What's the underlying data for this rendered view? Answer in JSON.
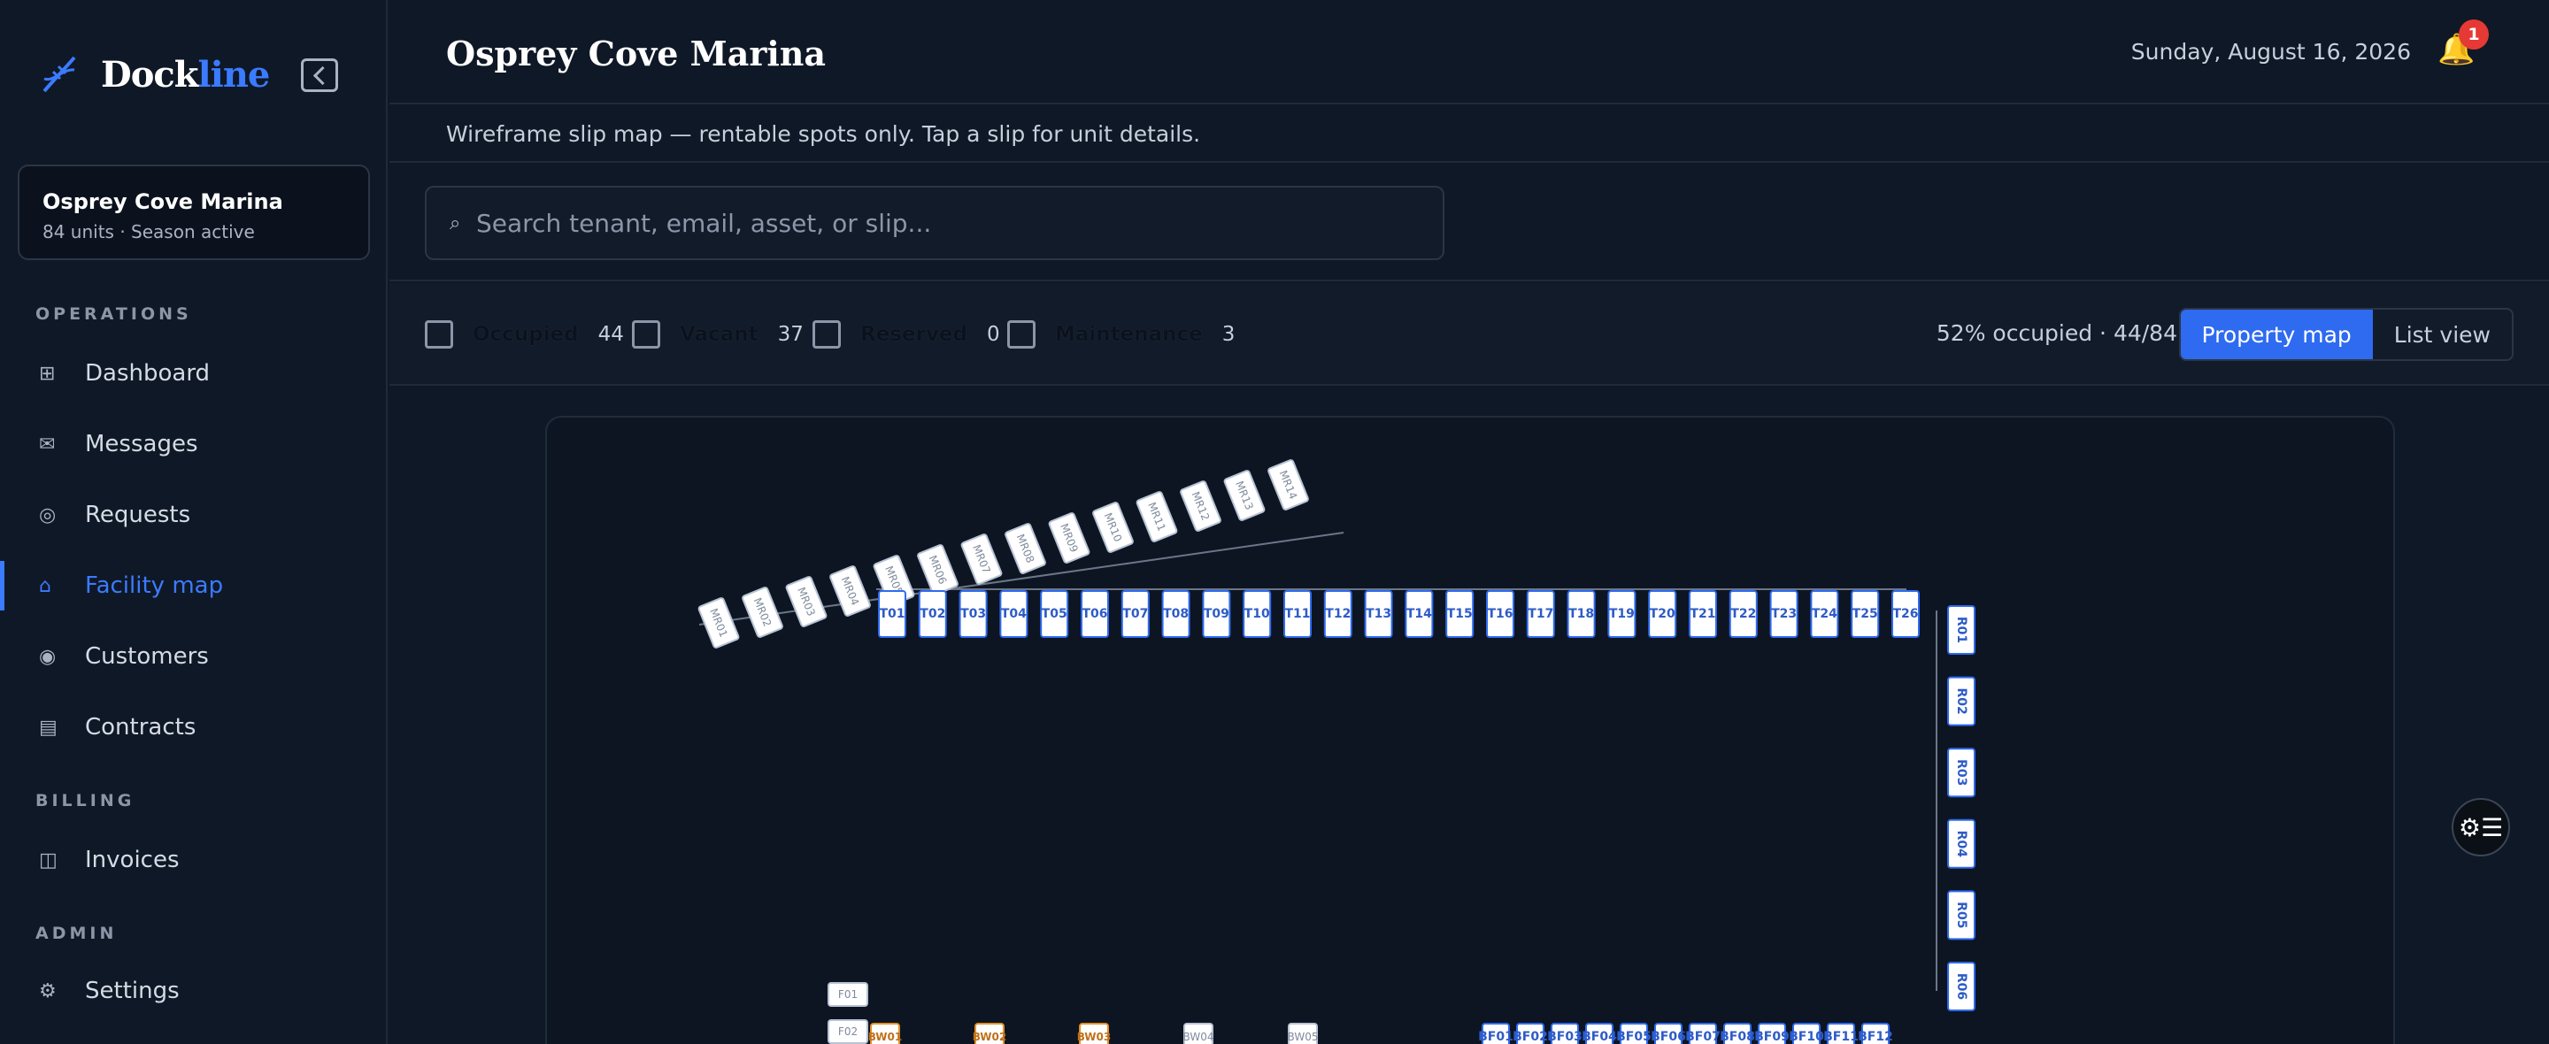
{
  "brand": {
    "name_main": "Dock",
    "name_accent": "line"
  },
  "property": {
    "name": "Osprey Cove Marina",
    "subtitle": "84 units · Season active"
  },
  "nav": {
    "operations_label": "OPERATIONS",
    "billing_label": "BILLING",
    "admin_label": "ADMIN",
    "items": [
      {
        "label": "Dashboard",
        "icon": "grid-icon"
      },
      {
        "label": "Messages",
        "icon": "mail-icon"
      },
      {
        "label": "Requests",
        "icon": "circle-icon"
      },
      {
        "label": "Facility map",
        "icon": "home-icon",
        "active": true
      },
      {
        "label": "Customers",
        "icon": "user-icon"
      },
      {
        "label": "Contracts",
        "icon": "file-icon"
      },
      {
        "label": "Invoices",
        "icon": "invoice-icon"
      },
      {
        "label": "Settings",
        "icon": "gear-icon"
      }
    ]
  },
  "header": {
    "title": "Osprey Cove Marina",
    "date": "Sunday, August 16, 2026",
    "notifications": "1"
  },
  "subheader": {
    "text": "Wireframe slip map — rentable spots only. Tap a slip for unit details."
  },
  "search": {
    "placeholder": "Search tenant, email, asset, or slip..."
  },
  "filters": [
    {
      "label": "Occupied",
      "count": "44"
    },
    {
      "label": "Vacant",
      "count": "37"
    },
    {
      "label": "Reserved",
      "count": "0"
    },
    {
      "label": "Maintenance",
      "count": "3"
    }
  ],
  "summary": {
    "text": "52% occupied · 44/84"
  },
  "view_toggle": {
    "property_map": "Property map",
    "list_view": "List view"
  },
  "map": {
    "mr_slips": [
      "MR01",
      "MR02",
      "MR03",
      "MR04",
      "MR05",
      "MR06",
      "MR07",
      "MR08",
      "MR09",
      "MR10",
      "MR11",
      "MR12",
      "MR13",
      "MR14"
    ],
    "t_slips": [
      "T01",
      "T02",
      "T03",
      "T04",
      "T05",
      "T06",
      "T07",
      "T08",
      "T09",
      "T10",
      "T11",
      "T12",
      "T13",
      "T14",
      "T15",
      "T16",
      "T17",
      "T18",
      "T19",
      "T20",
      "T21",
      "T22",
      "T23",
      "T24",
      "T25",
      "T26"
    ],
    "r_slips": [
      "R01",
      "R02",
      "R03",
      "R04",
      "R05",
      "R06"
    ],
    "f_slips": [
      "F01",
      "F02"
    ],
    "bw_slips": [
      "BW01",
      "BW02",
      "BW03",
      "BW04",
      "BW05"
    ],
    "bf_slips": [
      "BF01",
      "BF02",
      "BF03",
      "BF04",
      "BF05",
      "BF06",
      "BF07",
      "BF08",
      "BF09",
      "BF10",
      "BF11",
      "BF12"
    ]
  },
  "colors": {
    "accent": "#2e6bf0",
    "background": "#0f1826",
    "reserved": "#e0902a"
  }
}
